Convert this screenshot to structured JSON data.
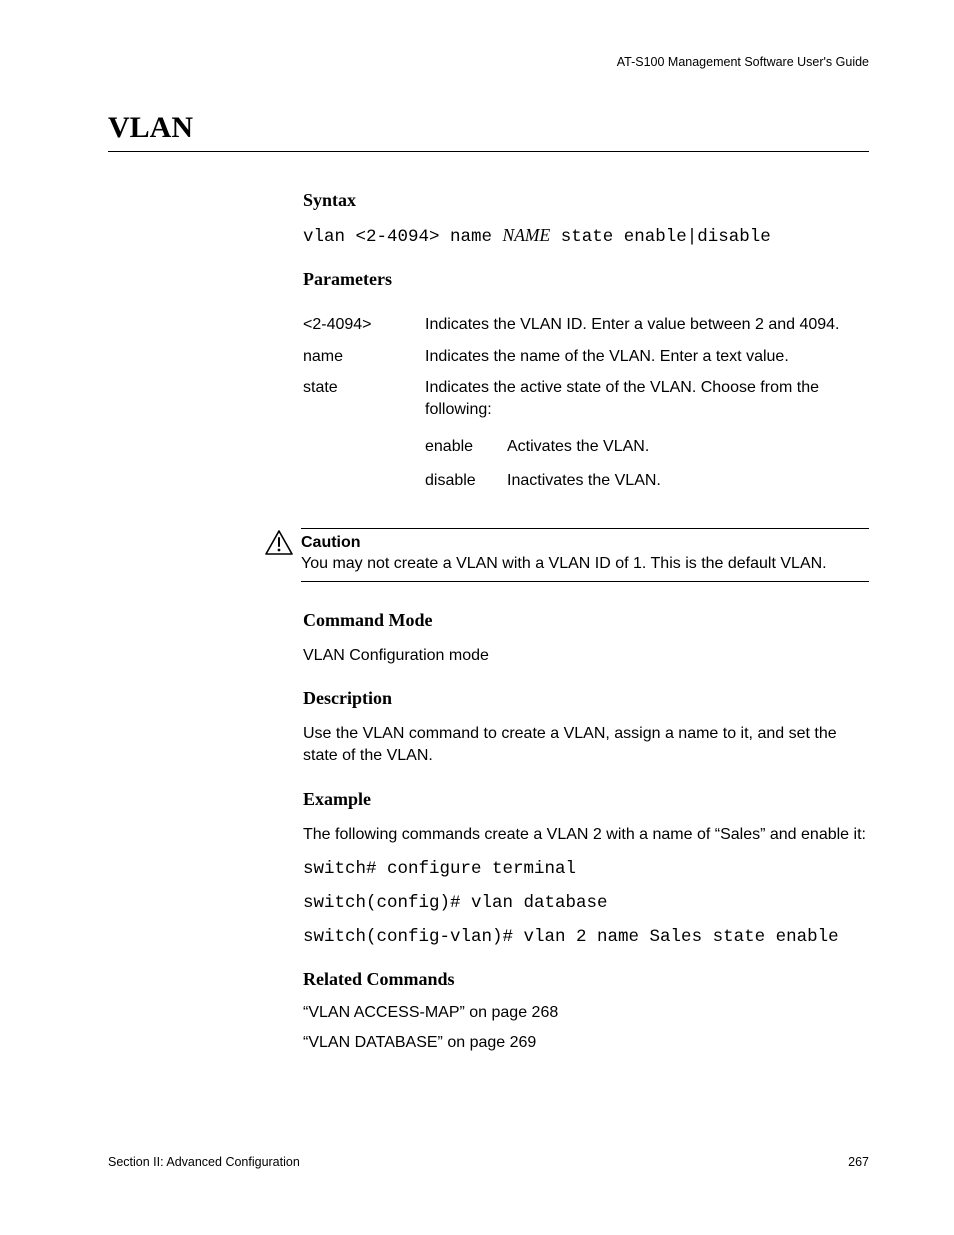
{
  "running_header": "AT-S100 Management Software User's Guide",
  "page_title": "VLAN",
  "syntax": {
    "heading": "Syntax",
    "line_prefix": "vlan <2-4094> name ",
    "line_var": "NAME",
    "line_suffix": " state enable|disable"
  },
  "parameters": {
    "heading": "Parameters",
    "rows": [
      {
        "term": "<2-4094>",
        "desc": "Indicates the VLAN ID. Enter a value between 2 and 4094."
      },
      {
        "term": "name",
        "desc": "Indicates the name of the VLAN. Enter a text value."
      },
      {
        "term": "state",
        "desc": "Indicates the active state of the VLAN. Choose from the following:"
      }
    ],
    "subopts": [
      {
        "term": "enable",
        "desc": "Activates the VLAN."
      },
      {
        "term": "disable",
        "desc": "Inactivates the VLAN."
      }
    ]
  },
  "caution": {
    "label": "Caution",
    "text": "You may not create a VLAN with a VLAN ID of 1. This is the default VLAN."
  },
  "command_mode": {
    "heading": "Command Mode",
    "text": "VLAN Configuration mode"
  },
  "description": {
    "heading": "Description",
    "text": "Use the VLAN command to create a VLAN, assign a name to it, and set the state of the VLAN."
  },
  "example": {
    "heading": "Example",
    "intro": "The following commands create a VLAN 2 with a name of “Sales” and enable it:",
    "lines": [
      "switch# configure terminal",
      "switch(config)# vlan database",
      "switch(config-vlan)# vlan 2 name Sales state enable"
    ]
  },
  "related": {
    "heading": "Related Commands",
    "links": [
      "“VLAN ACCESS-MAP” on page 268",
      "“VLAN DATABASE” on page 269"
    ]
  },
  "footer": {
    "section": "Section II: Advanced Configuration",
    "page": "267"
  }
}
